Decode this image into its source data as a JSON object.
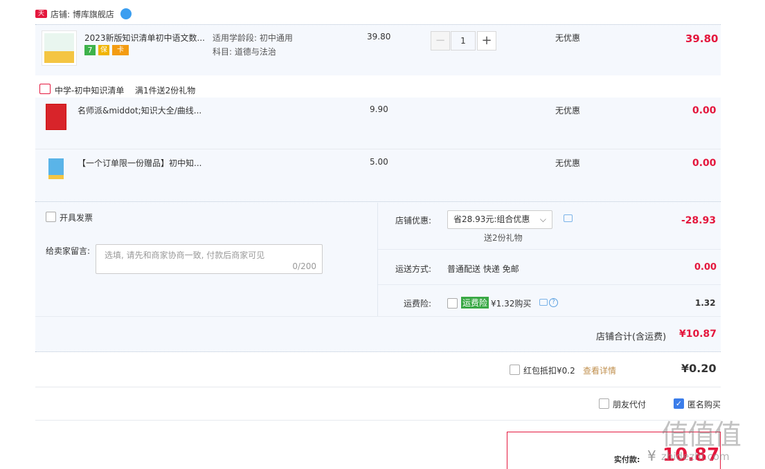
{
  "shop": {
    "badge": "天猫",
    "name": "店铺: 博库旗舰店"
  },
  "items": [
    {
      "title": "2023新版知识清单初中语文数...",
      "spec_line1": "适用学龄段: 初中通用",
      "spec_line2": "科目: 道德与法治",
      "price": "39.80",
      "quantity": "1",
      "discount": "无优惠",
      "subtotal": "39.80",
      "badges": [
        "7",
        "保",
        "卡"
      ]
    }
  ],
  "gift": {
    "label": "中学-初中知识清单",
    "rule": "满1件送2份礼物",
    "items": [
      {
        "title": "名师派&middot;知识大全/曲线...",
        "price": "9.90",
        "discount": "无优惠",
        "subtotal": "0.00"
      },
      {
        "title": "【一个订单限一份赠品】初中知...",
        "price": "5.00",
        "discount": "无优惠",
        "subtotal": "0.00"
      }
    ]
  },
  "invoice": {
    "label": "开具发票"
  },
  "message": {
    "label": "给卖家留言:",
    "placeholder": "选填, 请先和商家协商一致, 付款后商家可见",
    "counter": "0/200"
  },
  "shop_discount": {
    "label": "店铺优惠:",
    "selected": "省28.93元:组合优惠",
    "note": "送2份礼物",
    "amount": "-28.93"
  },
  "shipping": {
    "label": "运送方式:",
    "value": "普通配送 快递 免邮",
    "amount": "0.00"
  },
  "insurance": {
    "label": "运费险:",
    "tag": "运费险",
    "price_text": "¥1.32购买",
    "amount": "1.32"
  },
  "shop_total": {
    "label": "店铺合计(含运费)",
    "amount": "¥10.87"
  },
  "redpacket": {
    "label": "红包抵扣¥0.2",
    "link": "查看详情",
    "amount": "¥0.20"
  },
  "options": {
    "friend_pay": "朋友代付",
    "anonymous": "匿名购买"
  },
  "pay": {
    "label": "实付款:",
    "currency": "¥",
    "amount": "10.87"
  },
  "watermark": {
    "text": "值值值",
    "domain": "zhidezhi.com"
  }
}
